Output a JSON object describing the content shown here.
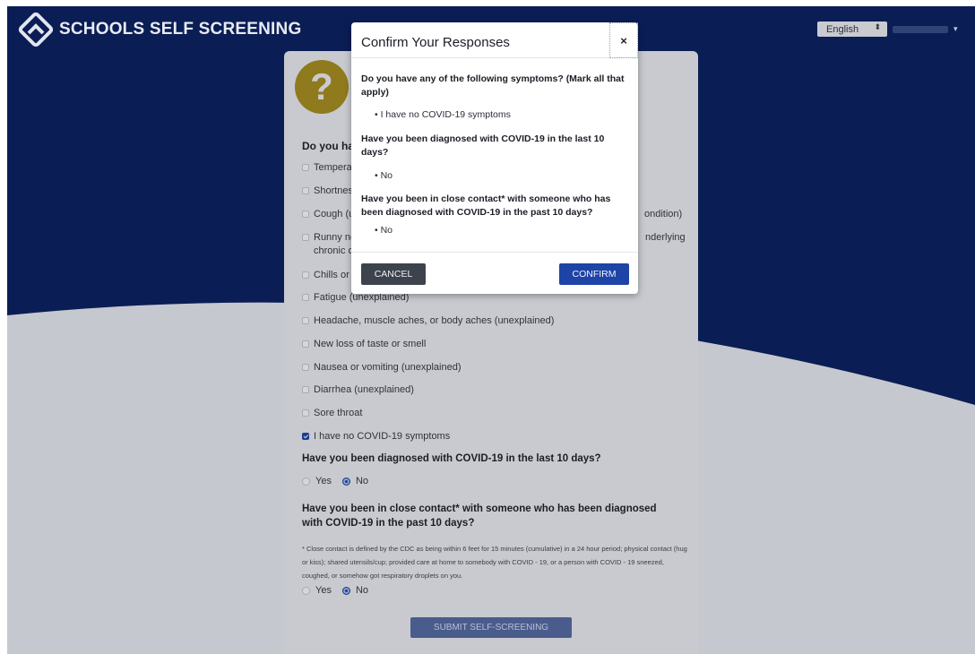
{
  "app": {
    "name": "SCHOOLS SELF SCREENING"
  },
  "header": {
    "language": "English"
  },
  "form": {
    "q1_label": "Do you hav",
    "symptoms": [
      {
        "label": "Temperat",
        "checked": false
      },
      {
        "label": "Shortnes",
        "checked": false
      },
      {
        "label": "Cough (u",
        "checked": false
      },
      {
        "label": "Runny no",
        "label2": "chronic c",
        "checked": false
      },
      {
        "label": "Chills or",
        "checked": false
      },
      {
        "label": "Fatigue (unexplained)",
        "checked": false
      },
      {
        "label": "Headache, muscle aches, or body aches (unexplained)",
        "checked": false
      },
      {
        "label": "New loss of taste or smell",
        "checked": false
      },
      {
        "label": "Nausea or vomiting (unexplained)",
        "checked": false
      },
      {
        "label": "Diarrhea (unexplained)",
        "checked": false
      },
      {
        "label": "Sore throat",
        "checked": false
      },
      {
        "label": "I have no COVID-19 symptoms",
        "checked": true
      }
    ],
    "right_fragments": {
      "cough": "ondition)",
      "runny": "nderlying"
    },
    "q2_label": "Have you been diagnosed with COVID-19 in the last 10 days?",
    "q2_options": {
      "yes": "Yes",
      "no": "No",
      "selected": "No"
    },
    "q3_label": "Have you been in close contact* with someone who has been diagnosed with COVID-19 in the past 10 days?",
    "q3_note": "* Close contact is defined by the CDC as being within 6 feet for 15 minutes (cumulative) in a 24 hour period; physical contact (hug or kiss); shared utensils/cup; provided care at home to somebody with COVID - 19, or a person with COVID - 19 sneezed, coughed, or somehow got respiratory droplets on you.",
    "q3_options": {
      "yes": "Yes",
      "no": "No",
      "selected": "No"
    },
    "submit_label": "SUBMIT SELF-SCREENING"
  },
  "modal": {
    "title": "Confirm Your Responses",
    "close_label": "×",
    "questions": [
      {
        "q": "Do you have any of the following symptoms? (Mark all that apply)",
        "answer": "I have no COVID-19 symptoms"
      },
      {
        "q": "Have you been diagnosed with COVID-19 in the last 10 days?",
        "answer": "No"
      },
      {
        "q": "Have you been in close contact* with someone who has been diagnosed with COVID-19 in the past 10 days?",
        "answer": "No"
      }
    ],
    "cancel_label": "CANCEL",
    "confirm_label": "CONFIRM"
  },
  "colors": {
    "navy": "#0b1d55",
    "overlay_grey": "#c6c8cf",
    "confirm_blue": "#1d44a6",
    "cancel_grey": "#3d434d",
    "badge_gold": "#8f7a1d"
  }
}
